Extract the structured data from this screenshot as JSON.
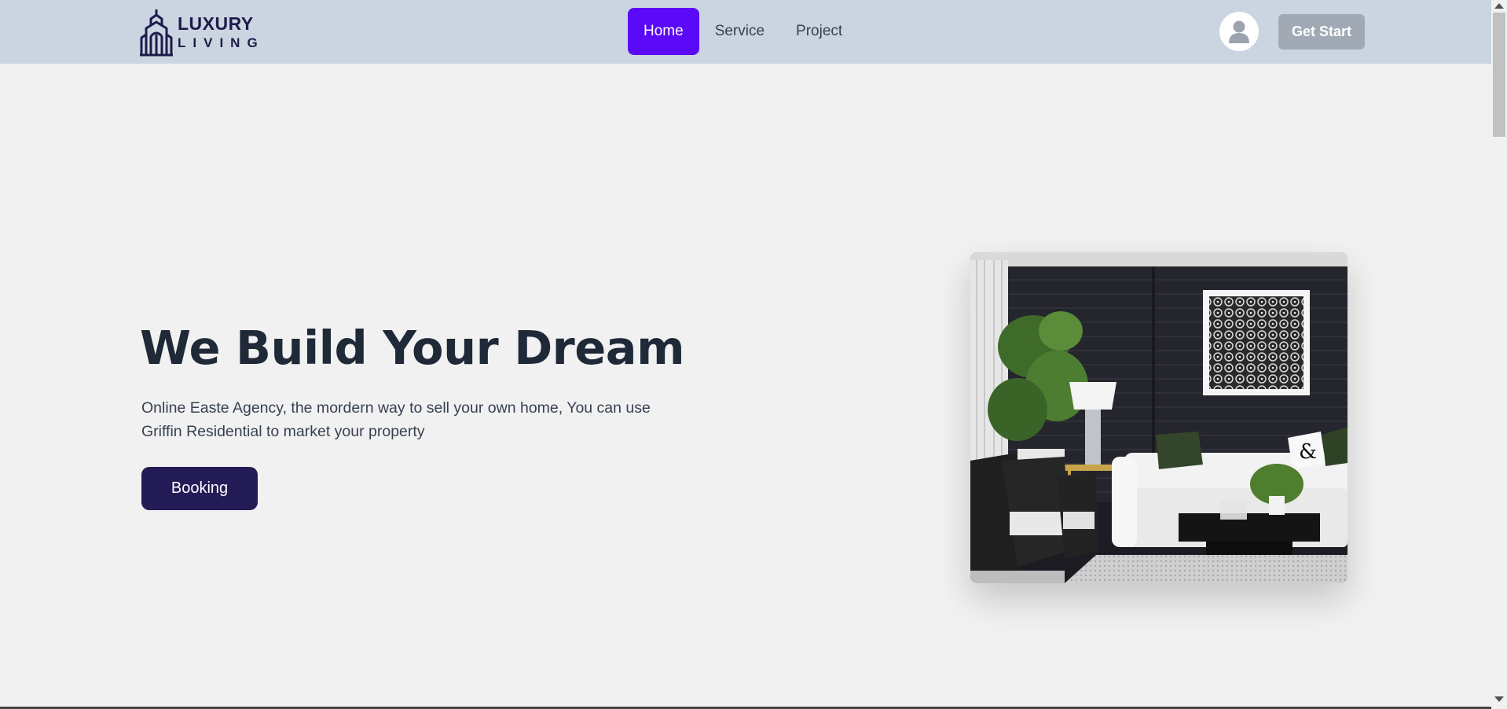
{
  "brand": {
    "name_top": "LUXURY",
    "name_bottom": "LIVING",
    "icon": "building-logo-icon",
    "color": "#1e1b4b"
  },
  "nav": {
    "items": [
      {
        "label": "Home",
        "active": true
      },
      {
        "label": "Service",
        "active": false
      },
      {
        "label": "Project",
        "active": false
      }
    ],
    "active_color": "#5b0af7"
  },
  "header": {
    "avatar_icon": "user-avatar-icon",
    "cta_label": "Get Start"
  },
  "hero": {
    "title": "We Build Your Dream",
    "description": "Online Easte Agency, the mordern way to sell your own home, You can use Griffin Residential to market your property",
    "button_label": "Booking",
    "image": "living-room-photo"
  },
  "colors": {
    "navbar_bg": "#cbd5e1",
    "page_bg": "#f1f1f1",
    "booking_bg": "#231c57",
    "cta_bg": "#a1aab4"
  }
}
